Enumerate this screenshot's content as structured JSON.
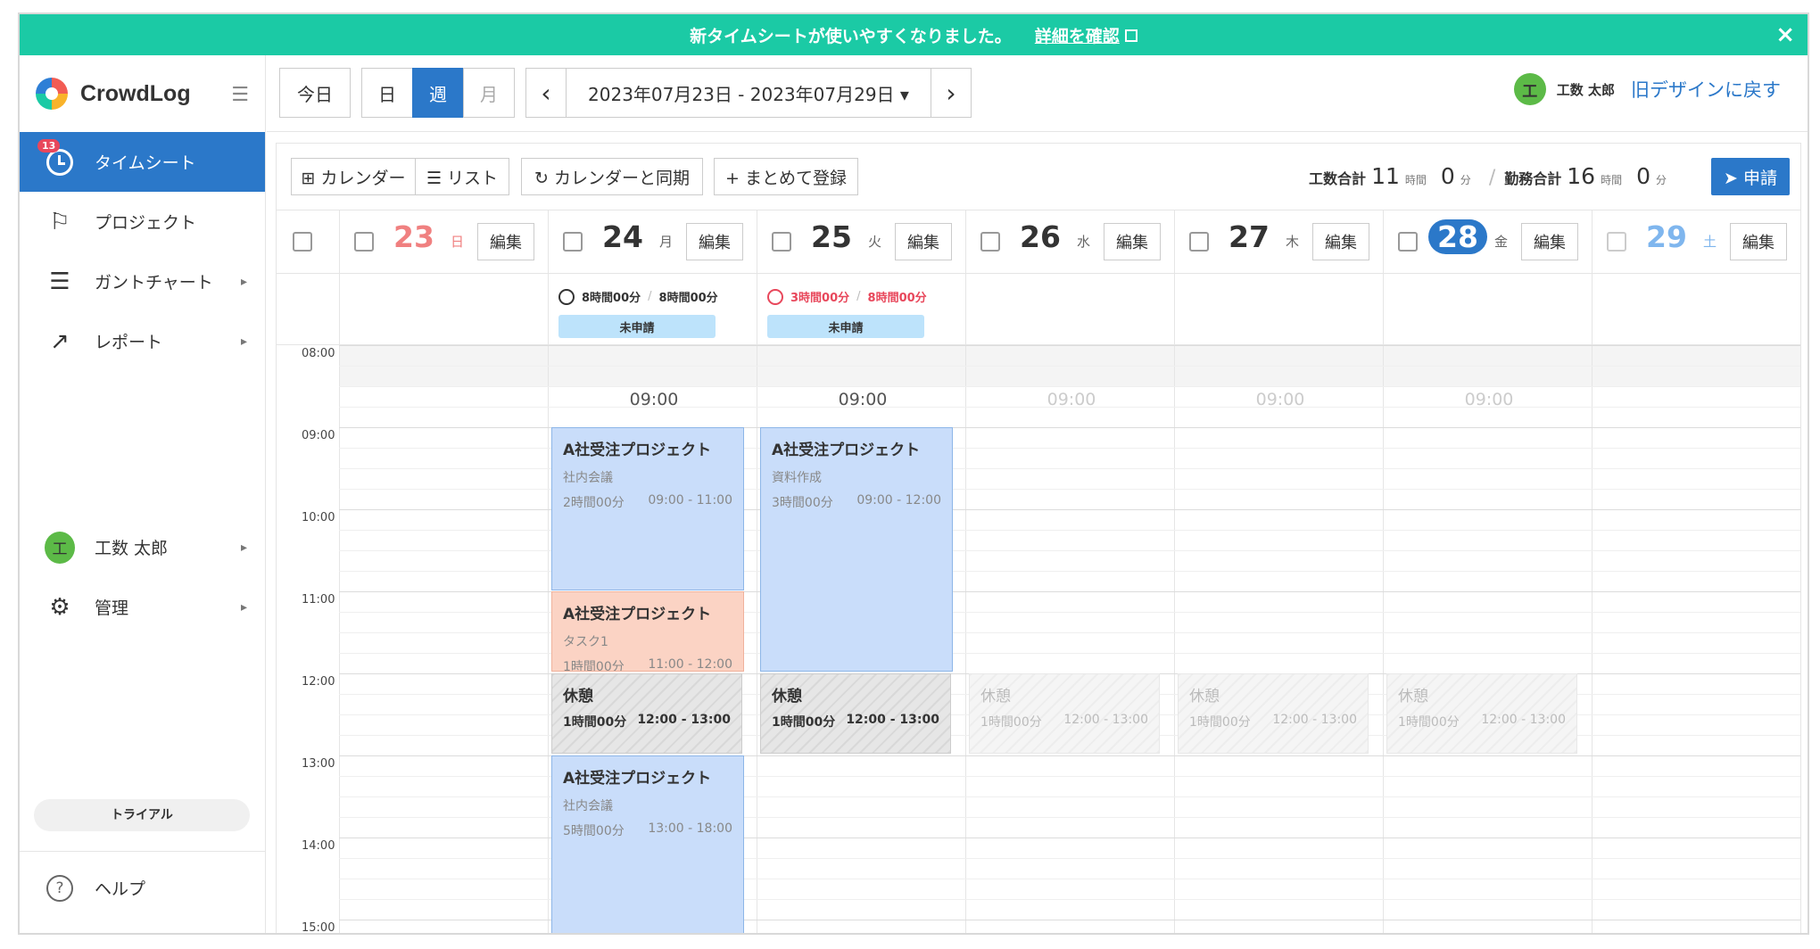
{
  "banner": {
    "message": "新タイムシートが使いやすくなりました。",
    "link": "詳細を確認",
    "close": "×"
  },
  "sidebar": {
    "logo": "CrowdLog",
    "items": [
      {
        "label": "タイムシート",
        "badge": "13",
        "icon": "clock-icon"
      },
      {
        "label": "プロジェクト",
        "icon": "flag-icon"
      },
      {
        "label": "ガントチャート",
        "icon": "gantt-icon"
      },
      {
        "label": "レポート",
        "icon": "trend-icon"
      }
    ],
    "user": {
      "initial": "工",
      "name": "工数 太郎"
    },
    "admin": "管理",
    "trial": "トライアル",
    "help": "ヘルプ"
  },
  "topbar": {
    "today": "今日",
    "view_day": "日",
    "view_week": "週",
    "view_month": "月",
    "prev": "‹",
    "next": "›",
    "range": "2023年07月23日 - 2023年07月29日 ▾",
    "user_initial": "工",
    "user_name": "工数 太郎",
    "old_design": "旧デザインに戻す"
  },
  "tools": {
    "calendar": "⊞ カレンダー",
    "list": "☰ リスト",
    "sync": "↻ カレンダーと同期",
    "bulk": "+ まとめて登録",
    "work_total_label": "工数合計",
    "work_hours": "11",
    "work_minutes": "0",
    "duty_total_label": "勤務合計",
    "duty_hours": "16",
    "duty_minutes": "0",
    "hour_unit": "時間",
    "minute_unit": "分",
    "submit": "➤ 申請"
  },
  "days": [
    {
      "num": "23",
      "wd": "日",
      "color": "#f08080"
    },
    {
      "num": "24",
      "wd": "月",
      "color": "#333333",
      "work": "8時間00分",
      "duty": "8時間00分",
      "status": "未申請",
      "ok": true
    },
    {
      "num": "25",
      "wd": "火",
      "color": "#333333",
      "work": "3時間00分",
      "duty": "8時間00分",
      "status": "未申請",
      "ok": false
    },
    {
      "num": "26",
      "wd": "水",
      "color": "#333333"
    },
    {
      "num": "27",
      "wd": "木",
      "color": "#333333"
    },
    {
      "num": "28",
      "wd": "金",
      "color": "#ffffff",
      "today": true
    },
    {
      "num": "29",
      "wd": "土",
      "color": "#7fb6ee"
    }
  ],
  "edit_label": "編集",
  "hours": [
    "08:00",
    "09:00",
    "10:00",
    "11:00",
    "12:00",
    "13:00",
    "14:00",
    "15:00"
  ],
  "work_start": "09:00",
  "events": {
    "mon_1": {
      "project": "A社受注プロジェクト",
      "task": "社内会議",
      "duration": "2時間00分",
      "range": "09:00 - 11:00"
    },
    "mon_2": {
      "project": "A社受注プロジェクト",
      "task": "タスク1",
      "duration": "1時間00分",
      "range": "11:00 - 12:00"
    },
    "mon_3": {
      "project": "A社受注プロジェクト",
      "task": "社内会議",
      "duration": "5時間00分",
      "range": "13:00 - 18:00"
    },
    "tue_1": {
      "project": "A社受注プロジェクト",
      "task": "資料作成",
      "duration": "3時間00分",
      "range": "09:00 - 12:00"
    }
  },
  "break": {
    "label": "休憩",
    "duration": "1時間00分",
    "range": "12:00 - 13:00"
  }
}
